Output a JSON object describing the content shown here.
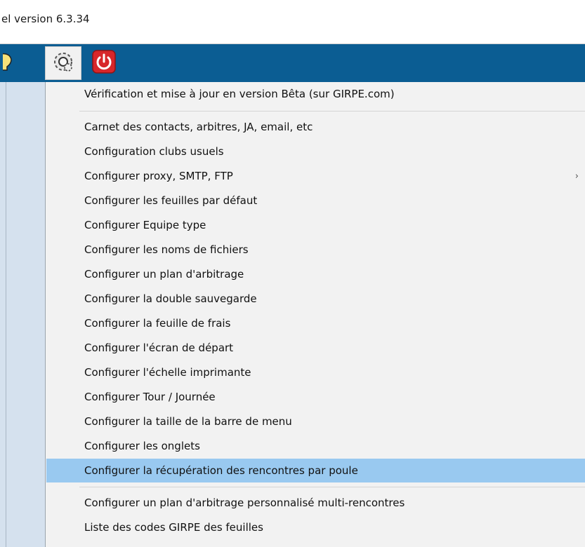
{
  "window": {
    "title": "el version  6.3.34"
  },
  "toolbar": {
    "buttons": [
      {
        "icon": "lightbulb-icon"
      },
      {
        "icon": "gear-icon"
      },
      {
        "icon": "power-icon"
      }
    ]
  },
  "menu": {
    "beta_item": "Vérification et mise à jour en version Bêta (sur GIRPE.com)",
    "items": [
      "Carnet des contacts, arbitres, JA, email, etc",
      "Configuration clubs usuels",
      "Configurer proxy, SMTP, FTP",
      "Configurer les feuilles par défaut",
      "Configurer Equipe type",
      "Configurer les noms de fichiers",
      "Configurer un plan d'arbitrage",
      "Configurer la double sauvegarde",
      "Configurer la feuille de frais",
      "Configurer l'écran de départ",
      "Configurer l'échelle imprimante",
      "Configurer Tour / Journée",
      "Configurer la taille de la barre de menu",
      "Configurer les onglets",
      "Configurer la récupération des rencontres par poule"
    ],
    "submenu_arrow": "›",
    "bottom_items": [
      "Configurer un plan d'arbitrage personnalisé multi-rencontres",
      "Liste des codes GIRPE des feuilles"
    ]
  }
}
